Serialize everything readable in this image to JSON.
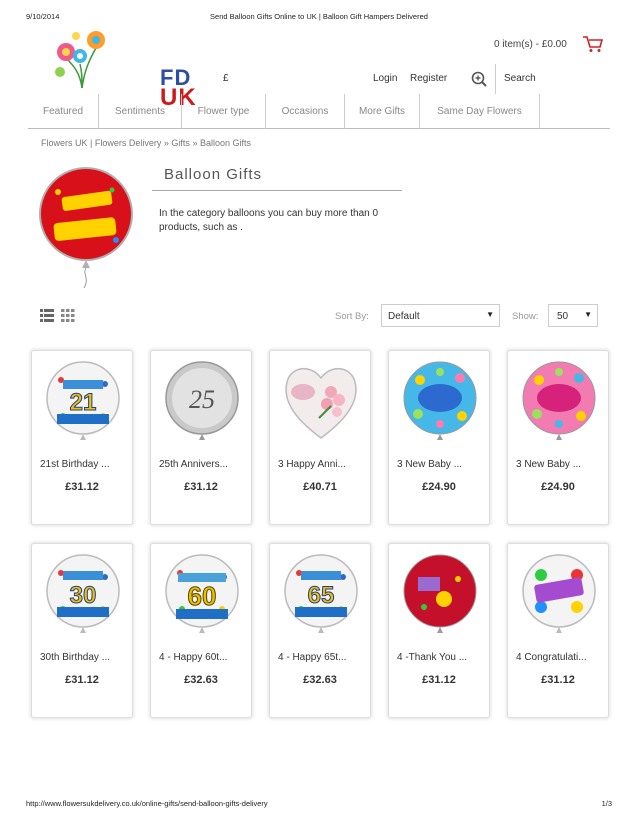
{
  "print_header": {
    "date": "9/10/2014",
    "title": "Send Balloon Gifts Online to UK | Balloon Gift Hampers Delivered"
  },
  "logo": {
    "line1": "FD",
    "line2": "UK"
  },
  "header": {
    "cart_text": "0 item(s) - £0.00",
    "currency": "£",
    "login": "Login",
    "register": "Register",
    "search": "Search"
  },
  "nav": {
    "items": [
      {
        "label": "Featured"
      },
      {
        "label": "Sentiments"
      },
      {
        "label": "Flower type"
      },
      {
        "label": "Occasions"
      },
      {
        "label": "More Gifts"
      },
      {
        "label": "Same Day Flowers"
      }
    ]
  },
  "breadcrumb": {
    "items": [
      "Flowers UK | Flowers Delivery",
      "Gifts",
      "Balloon Gifts"
    ],
    "separator": "»"
  },
  "category": {
    "title": "Balloon Gifts",
    "description": "In the category balloons you can buy more than 0 products, such as ."
  },
  "toolbar": {
    "sort_label": "Sort By:",
    "sort_value": "Default",
    "show_label": "Show:",
    "show_value": "50"
  },
  "products": [
    {
      "name": "21st Birthday ...",
      "price": "£31.12",
      "number": "21"
    },
    {
      "name": "25th Annivers...",
      "price": "£31.12",
      "number": "25"
    },
    {
      "name": "3 Happy Anni...",
      "price": "£40.71",
      "number": ""
    },
    {
      "name": "3 New Baby ...",
      "price": "£24.90",
      "number": ""
    },
    {
      "name": "3 New Baby ...",
      "price": "£24.90",
      "number": ""
    },
    {
      "name": "30th Birthday ...",
      "price": "£31.12",
      "number": "30"
    },
    {
      "name": "4 - Happy 60t...",
      "price": "£32.63",
      "number": "60"
    },
    {
      "name": "4 - Happy 65t...",
      "price": "£32.63",
      "number": "65"
    },
    {
      "name": "4 -Thank You ...",
      "price": "£31.12",
      "number": ""
    },
    {
      "name": "4 Congratulati...",
      "price": "£31.12",
      "number": ""
    }
  ],
  "print_footer": {
    "url": "http://www.flowersukdelivery.co.uk/online-gifts/send-balloon-gifts-delivery",
    "page": "1/3"
  },
  "colors": {
    "brand_blue": "#2d4fa3",
    "brand_red": "#cc1b1b",
    "cart_red": "#d32020"
  }
}
